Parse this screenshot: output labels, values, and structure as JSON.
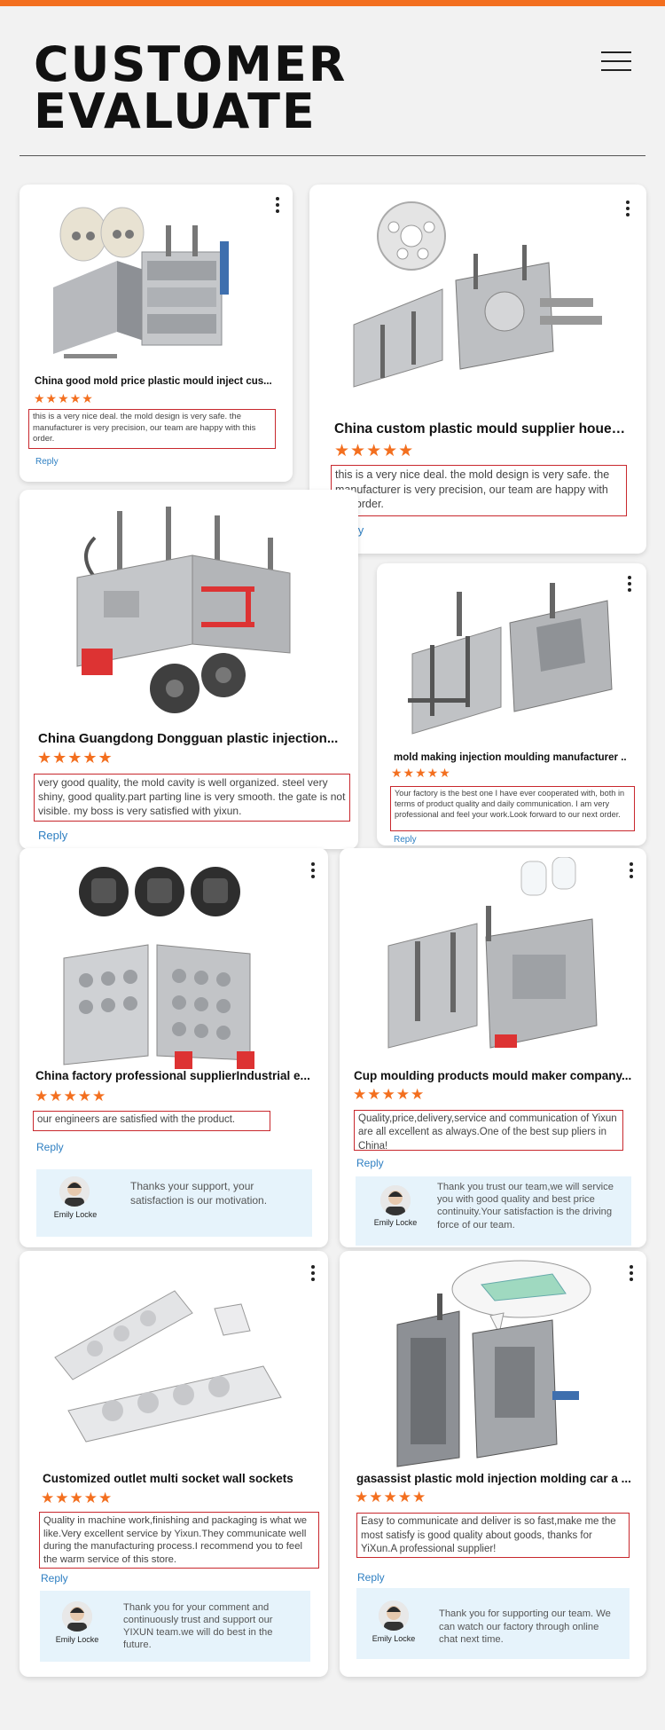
{
  "header": {
    "title_line1": "CUSTOMER",
    "title_line2": "EVALUATE"
  },
  "icons": {
    "menu": "hamburger-menu-icon",
    "more": "more-vertical-icon",
    "star": "star-icon"
  },
  "colors": {
    "accent": "#f36f1f",
    "review_border": "#c8282d",
    "reply_link": "#2e7fc2",
    "answer_bg": "#e6f3fb"
  },
  "cards": [
    {
      "title": "China good mold price plastic mould inject cus...",
      "rating": 5,
      "review": "this is a very nice deal. the mold design is very safe. the manufacturer is very precision, our team are happy with this order.",
      "reply_label": "Reply"
    },
    {
      "title": "China custom plastic mould supplier houehol...",
      "rating": 5,
      "review": "this is a very nice deal. the mold design is very safe. the manufacturer is very precision, our team are happy with this order.",
      "reply_label": "Reply"
    },
    {
      "title": "China Guangdong Dongguan plastic injection...",
      "rating": 5,
      "review": "very good quality, the mold cavity is well organized. steel very shiny, good quality.part parting line is very smooth. the gate is not visible. my boss is very satisfied with yixun.",
      "reply_label": "Reply"
    },
    {
      "title": "mold making injection moulding manufacturer ..",
      "rating": 5,
      "review": "Your factory is the best one I have ever cooperated with, both in terms of product quality and daily communication. I am very professional and feel your work.Look forward to our next order.",
      "reply_label": "Reply"
    },
    {
      "title": "China factory professional supplierIndustrial e...",
      "rating": 5,
      "review": "our engineers are satisfied with the product.",
      "reply_label": "Reply",
      "answer": {
        "name": "Emily Locke",
        "text": "Thanks your support, your satisfaction is our motivation."
      }
    },
    {
      "title": "Cup moulding products mould maker company...",
      "rating": 5,
      "review": "Quality,price,delivery,service and communication of Yixun are all excellent as always.One of the best sup pliers in China!",
      "reply_label": "Reply",
      "answer": {
        "name": "Emily Locke",
        "text": "Thank you trust our team,we will service you with good quality and best price continuity.Your satisfaction is the driving force of our team."
      }
    },
    {
      "title": "Customized outlet multi socket wall sockets",
      "rating": 5,
      "review": "Quality in machine work,finishing and packaging is what we like.Very excellent service by Yixun.They communicate well during the manufacturing process.I recommend you to feel the warm service of this store.",
      "reply_label": "Reply",
      "answer": {
        "name": "Emily Locke",
        "text": "Thank you for your comment and continuously trust and support our YIXUN team.we will do best in the future."
      }
    },
    {
      "title": "gasassist plastic mold injection molding car a ...",
      "rating": 5,
      "review": "Easy to communicate and deliver is so fast,make me the most satisfy is good quality about goods, thanks for YiXun.A professional supplier!",
      "reply_label": "Reply",
      "answer": {
        "name": "Emily Locke",
        "text": "Thank you for supporting our team. We can watch our factory through online chat next time."
      }
    }
  ]
}
